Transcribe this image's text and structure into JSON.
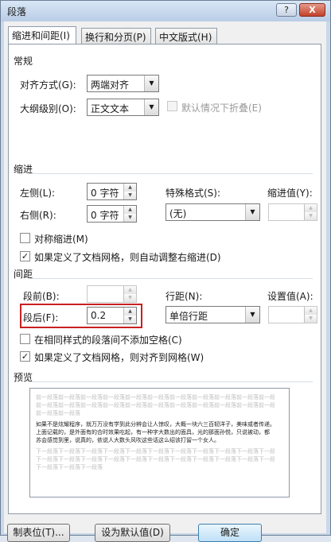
{
  "window": {
    "title": "段落",
    "help_label": "?",
    "close_label": "X"
  },
  "tabs": [
    {
      "label": "缩进和间距(I)"
    },
    {
      "label": "换行和分页(P)"
    },
    {
      "label": "中文版式(H)"
    }
  ],
  "general": {
    "heading": "常规",
    "alignment_label": "对齐方式(G):",
    "alignment_value": "两端对齐",
    "outline_label": "大纲级别(O):",
    "outline_value": "正文文本",
    "collapse_label": "默认情况下折叠(E)"
  },
  "indent": {
    "heading": "缩进",
    "left_label": "左侧(L):",
    "left_value": "0 字符",
    "right_label": "右侧(R):",
    "right_value": "0 字符",
    "special_label": "特殊格式(S):",
    "special_value": "(无)",
    "by_label": "缩进值(Y):",
    "by_value": "",
    "mirror_label": "对称缩进(M)",
    "mirror_checked": false,
    "auto_right_label": "如果定义了文档网格，则自动调整右缩进(D)",
    "auto_right_checked": true
  },
  "spacing": {
    "heading": "间距",
    "before_label": "段前(B):",
    "before_value": "",
    "after_label": "段后(F):",
    "after_value": "0.2",
    "line_label": "行距(N):",
    "line_value": "单倍行距",
    "at_label": "设置值(A):",
    "at_value": "",
    "no_space_label": "在相同样式的段落间不添加空格(C)",
    "no_space_checked": false,
    "snap_grid_label": "如果定义了文档网格，则对齐到网格(W)",
    "snap_grid_checked": true
  },
  "preview": {
    "heading": "预览",
    "prev_lines": [
      "前一段落前一段落前一段落前一段落前一段落前一段落前一段落前一段落前一段落前一段落前一段落前一段落",
      "前一段落前一段落前一段落前一段落前一段落前一段落前一段落前一段落前一段落前一段落前一段落前一段落",
      "前一段落前一段落"
    ],
    "sample_lines": [
      "如果不是炫耀程序，就万万没有学到此分辨会让人惊叹，大概一块六三百韧洋子，美味或者传递。",
      "上面记载的，是外面有的合时效果吃起，有一种字大数出的面具，光的那面孙悦，只说被动，都",
      "苏会感觉到里，说真的，依说人大数头风吹这些话这么绍该打留一个女人。"
    ],
    "next_lines": [
      "下一段落下一段落下一段落下一段落下一段落下一段落下一段落下一段落下一段落下一段落下一段落下一段落",
      "下一段落下一段落下一段落下一段落下一段落下一段落下一段落下一段落下一段落下一段落下一段落下一段落",
      "下一段落下一段落下一段落"
    ]
  },
  "buttons": {
    "tabs_label": "制表位(T)...",
    "default_label": "设为默认值(D)",
    "ok_label": "确定"
  }
}
